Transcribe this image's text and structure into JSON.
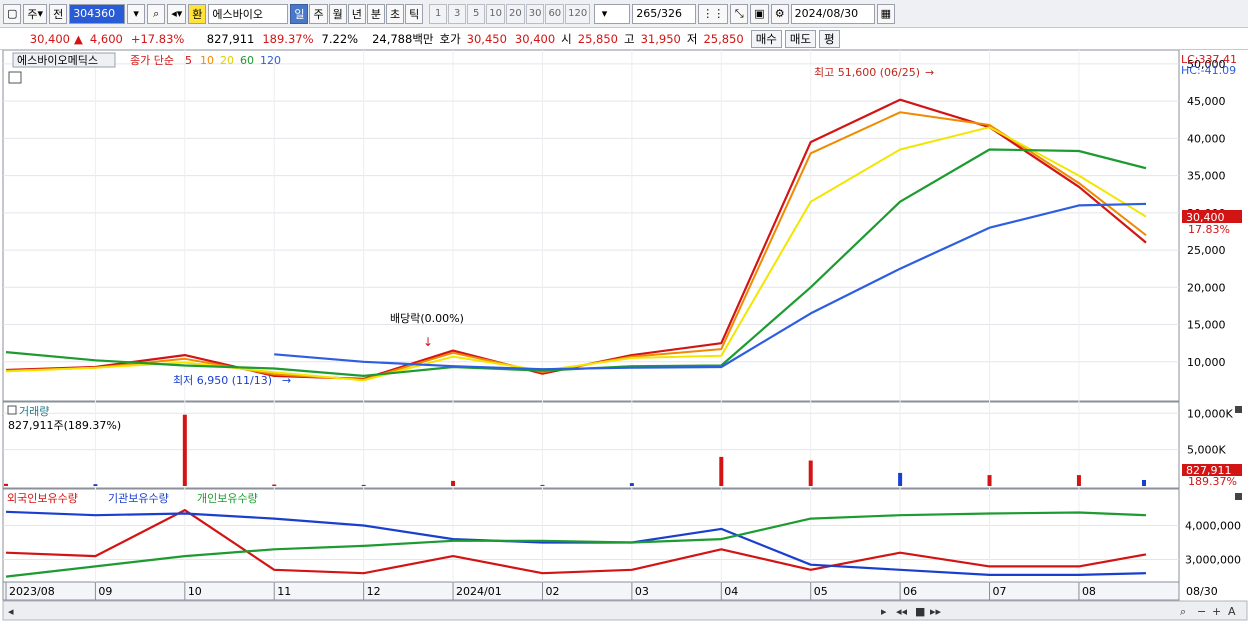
{
  "toolbar": {
    "type_label": "주",
    "prev_label": "전",
    "code": "304360",
    "exchange_badge": "환",
    "stock_name": "에스바이오",
    "periods": [
      "일",
      "주",
      "월",
      "년",
      "분",
      "초",
      "틱"
    ],
    "active_period": "일",
    "intervals": [
      "1",
      "3",
      "5",
      "10",
      "20",
      "30",
      "60",
      "120"
    ],
    "count": "265",
    "total": "/326",
    "date": "2024/08/30"
  },
  "quote": {
    "price": "30,400",
    "change": "4,600",
    "change_pct": "+17.83%",
    "volume": "827,911",
    "volume_ratio": "189.37%",
    "turnover": "7.22%",
    "amount": "24,788백만",
    "bid_label": "호가",
    "bid1": "30,450",
    "bid2": "30,400",
    "open_label": "시",
    "open": "25,850",
    "high_label": "고",
    "high": "31,950",
    "low_label": "저",
    "low": "25,850",
    "buy_button": "매수",
    "sell_button": "매도",
    "eval_button": "평"
  },
  "colors": {
    "up": "#d21414",
    "down": "#1a3fcf",
    "ma5": "#d21414",
    "ma10": "#f08a00",
    "ma20": "#f2e600",
    "ma60": "#1e9b30",
    "ma120": "#2e5ee0"
  },
  "chart_data": [
    {
      "type": "line",
      "title": "에스바이오메딕스",
      "legend": {
        "label": "종가 단순",
        "entries": [
          "5",
          "10",
          "20",
          "60",
          "120"
        ]
      },
      "corner_labels": [
        "LC:337.41",
        "HC:-41.09"
      ],
      "ylim": [
        5000,
        51600
      ],
      "yticks": [
        10000,
        15000,
        20000,
        25000,
        30000,
        35000,
        40000,
        45000,
        50000
      ],
      "ytick_labels": [
        "10,000",
        "15,000",
        "20,000",
        "25,000",
        "30,000",
        "35,000",
        "40,000",
        "45,000",
        "50,000"
      ],
      "last_price_label": "30,400",
      "last_change_label": "17.83%",
      "annotations": [
        {
          "text": "최고 51,600 (06/25)",
          "kind": "high"
        },
        {
          "text": "최저 6,950 (11/13)",
          "kind": "low"
        },
        {
          "text": "배당락(0.00%)",
          "kind": "dividend"
        }
      ],
      "x": [
        "2023/08",
        "09",
        "10",
        "11",
        "12",
        "2024/01",
        "02",
        "03",
        "04",
        "05",
        "06",
        "07",
        "08",
        "08/30"
      ],
      "series": [
        {
          "name": "5",
          "values": [
            8900,
            9300,
            10900,
            8100,
            7700,
            11500,
            8400,
            10900,
            12500,
            39500,
            45200,
            41500,
            33500,
            26000
          ]
        },
        {
          "name": "10",
          "values": [
            8800,
            9200,
            10400,
            8300,
            7600,
            11200,
            8600,
            10700,
            11700,
            38000,
            43500,
            41800,
            34000,
            27000
          ]
        },
        {
          "name": "20",
          "values": [
            8700,
            9200,
            9900,
            8600,
            7500,
            10700,
            8800,
            10500,
            10800,
            31500,
            38500,
            41500,
            35000,
            29500
          ]
        },
        {
          "name": "60",
          "values": [
            11300,
            10200,
            9500,
            9100,
            8100,
            9300,
            8800,
            9400,
            9500,
            20000,
            31500,
            38500,
            38300,
            36000
          ]
        },
        {
          "name": "120",
          "values": [
            null,
            null,
            null,
            11000,
            10000,
            9400,
            9000,
            9200,
            9300,
            16500,
            22500,
            28000,
            31000,
            31200
          ]
        }
      ]
    },
    {
      "type": "bar",
      "title": "거래량",
      "current_label": "827,911주(189.37%)",
      "ylim": [
        0,
        11000000
      ],
      "yticks": [
        5000000,
        10000000
      ],
      "ytick_labels": [
        "5,000K",
        "10,000K"
      ],
      "last_value_label": "827,911",
      "last_pct_label": "189.37%",
      "x": [
        "2023/08",
        "09",
        "10",
        "11",
        "12",
        "2024/01",
        "02",
        "03",
        "04",
        "05",
        "06",
        "07",
        "08",
        "08/30"
      ],
      "values": [
        300000,
        250000,
        9800000,
        200000,
        150000,
        700000,
        150000,
        400000,
        4000000,
        3500000,
        1800000,
        1500000,
        1500000,
        827911
      ]
    },
    {
      "type": "line",
      "legend_entries": [
        "외국인보유수량",
        "기관보유수량",
        "개인보유수량"
      ],
      "ylim": [
        2400000,
        4600000
      ],
      "yticks": [
        3000000,
        4000000
      ],
      "ytick_labels": [
        "3,000,000",
        "4,000,000"
      ],
      "x": [
        "2023/08",
        "09",
        "10",
        "11",
        "12",
        "2024/01",
        "02",
        "03",
        "04",
        "05",
        "06",
        "07",
        "08",
        "08/30"
      ],
      "series": [
        {
          "name": "외국인보유수량",
          "values": [
            3200000,
            3100000,
            4450000,
            2700000,
            2600000,
            3100000,
            2600000,
            2700000,
            3300000,
            2700000,
            3200000,
            2800000,
            2800000,
            3150000
          ]
        },
        {
          "name": "기관보유수량",
          "values": [
            4400000,
            4300000,
            4350000,
            4200000,
            4000000,
            3600000,
            3500000,
            3500000,
            3900000,
            2850000,
            2700000,
            2550000,
            2550000,
            2600000
          ]
        },
        {
          "name": "개인보유수량",
          "values": [
            2500000,
            2800000,
            3100000,
            3300000,
            3400000,
            3550000,
            3550000,
            3500000,
            3600000,
            4200000,
            4300000,
            4350000,
            4380000,
            4300000
          ]
        }
      ]
    }
  ]
}
